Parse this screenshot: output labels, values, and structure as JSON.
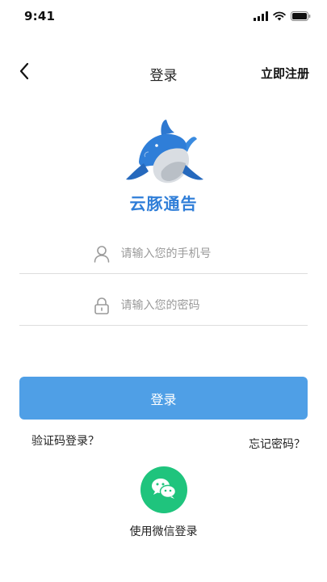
{
  "status_bar": {
    "time": "9:41",
    "icons": [
      "signal-icon",
      "wifi-icon",
      "battery-icon"
    ]
  },
  "nav": {
    "back_icon": "chevron-left-icon",
    "title": "登录",
    "register_label": "立即注册"
  },
  "logo": {
    "icon": "dolphin-logo-icon",
    "text": "云豚通告",
    "color": "#2f7ed8"
  },
  "form": {
    "phone": {
      "icon": "user-icon",
      "placeholder": "请输入您的手机号",
      "value": ""
    },
    "password": {
      "icon": "lock-icon",
      "placeholder": "请输入您的密码",
      "value": ""
    },
    "login_label": "登录",
    "sms_login_label": "验证码登录？",
    "forgot_label": "忘记密码？"
  },
  "wechat": {
    "icon": "wechat-icon",
    "label": "使用微信登录",
    "color": "#1fc47d"
  },
  "colors": {
    "primary": "#4f9fe6",
    "divider": "#dddddd",
    "placeholder": "#9a9a9a"
  }
}
